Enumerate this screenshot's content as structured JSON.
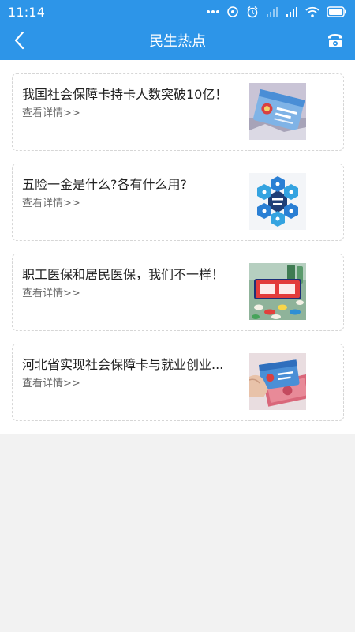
{
  "status_bar": {
    "time": "11:14",
    "icons": [
      "more-dots-icon",
      "hotspot-icon",
      "alarm-icon",
      "signal-icon",
      "signal-icon",
      "wifi-icon",
      "battery-icon"
    ]
  },
  "app_bar": {
    "title": "民生热点",
    "back_icon": "chevron-left-icon",
    "action_icon": "phone-icon"
  },
  "news": [
    {
      "title": "我国社会保障卡持卡人数突破10亿！",
      "link": "查看详情>>",
      "thumb": "social-security-card-image"
    },
    {
      "title": "五险一金是什么?各有什么用?",
      "link": "查看详情>>",
      "thumb": "five-insurances-diagram-image"
    },
    {
      "title": "职工医保和居民医保，我们不一样！",
      "link": "查看详情>>",
      "thumb": "medical-insurance-pills-image"
    },
    {
      "title": "河北省实现社会保障卡与就业创业...",
      "link": "查看详情>>",
      "thumb": "card-and-money-image"
    }
  ],
  "colors": {
    "primary": "#2d95e8",
    "background": "#f2f2f2",
    "card_border": "#d6d6d6"
  }
}
